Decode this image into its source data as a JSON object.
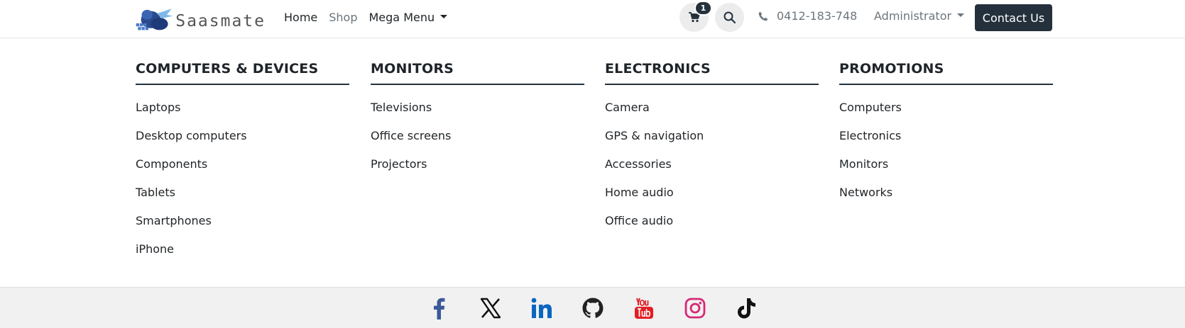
{
  "brand": {
    "name": "Saasmate"
  },
  "nav": {
    "items": [
      {
        "label": "Home",
        "muted": false
      },
      {
        "label": "Shop",
        "muted": true
      }
    ],
    "mega_label": "Mega Menu"
  },
  "cart": {
    "count": "1",
    "icon": "cart-icon"
  },
  "search": {
    "icon": "search-icon"
  },
  "phone": {
    "number": "0412-183-748",
    "icon": "phone-icon"
  },
  "user": {
    "label": "Administrator"
  },
  "contact": {
    "label": "Contact Us"
  },
  "mega_menu": {
    "columns": [
      {
        "title": "COMPUTERS & DEVICES",
        "items": [
          "Laptops",
          "Desktop computers",
          "Components",
          "Tablets",
          "Smartphones",
          "iPhone"
        ]
      },
      {
        "title": "MONITORS",
        "items": [
          "Televisions",
          "Office screens",
          "Projectors"
        ]
      },
      {
        "title": "ELECTRONICS",
        "items": [
          "Camera",
          "GPS & navigation",
          "Accessories",
          "Home audio",
          "Office audio"
        ]
      },
      {
        "title": "PROMOTIONS",
        "items": [
          "Computers",
          "Electronics",
          "Monitors",
          "Networks"
        ]
      }
    ]
  },
  "footer": {
    "socials": [
      {
        "name": "facebook-icon",
        "color": "#3b5998"
      },
      {
        "name": "x-icon",
        "color": "#111111"
      },
      {
        "name": "linkedin-icon",
        "color": "#0a66c2"
      },
      {
        "name": "github-icon",
        "color": "#222222"
      },
      {
        "name": "youtube-icon",
        "color": "#e31e24"
      },
      {
        "name": "instagram-icon",
        "color": "#d62976"
      },
      {
        "name": "tiktok-icon",
        "color": "#111111"
      }
    ]
  }
}
